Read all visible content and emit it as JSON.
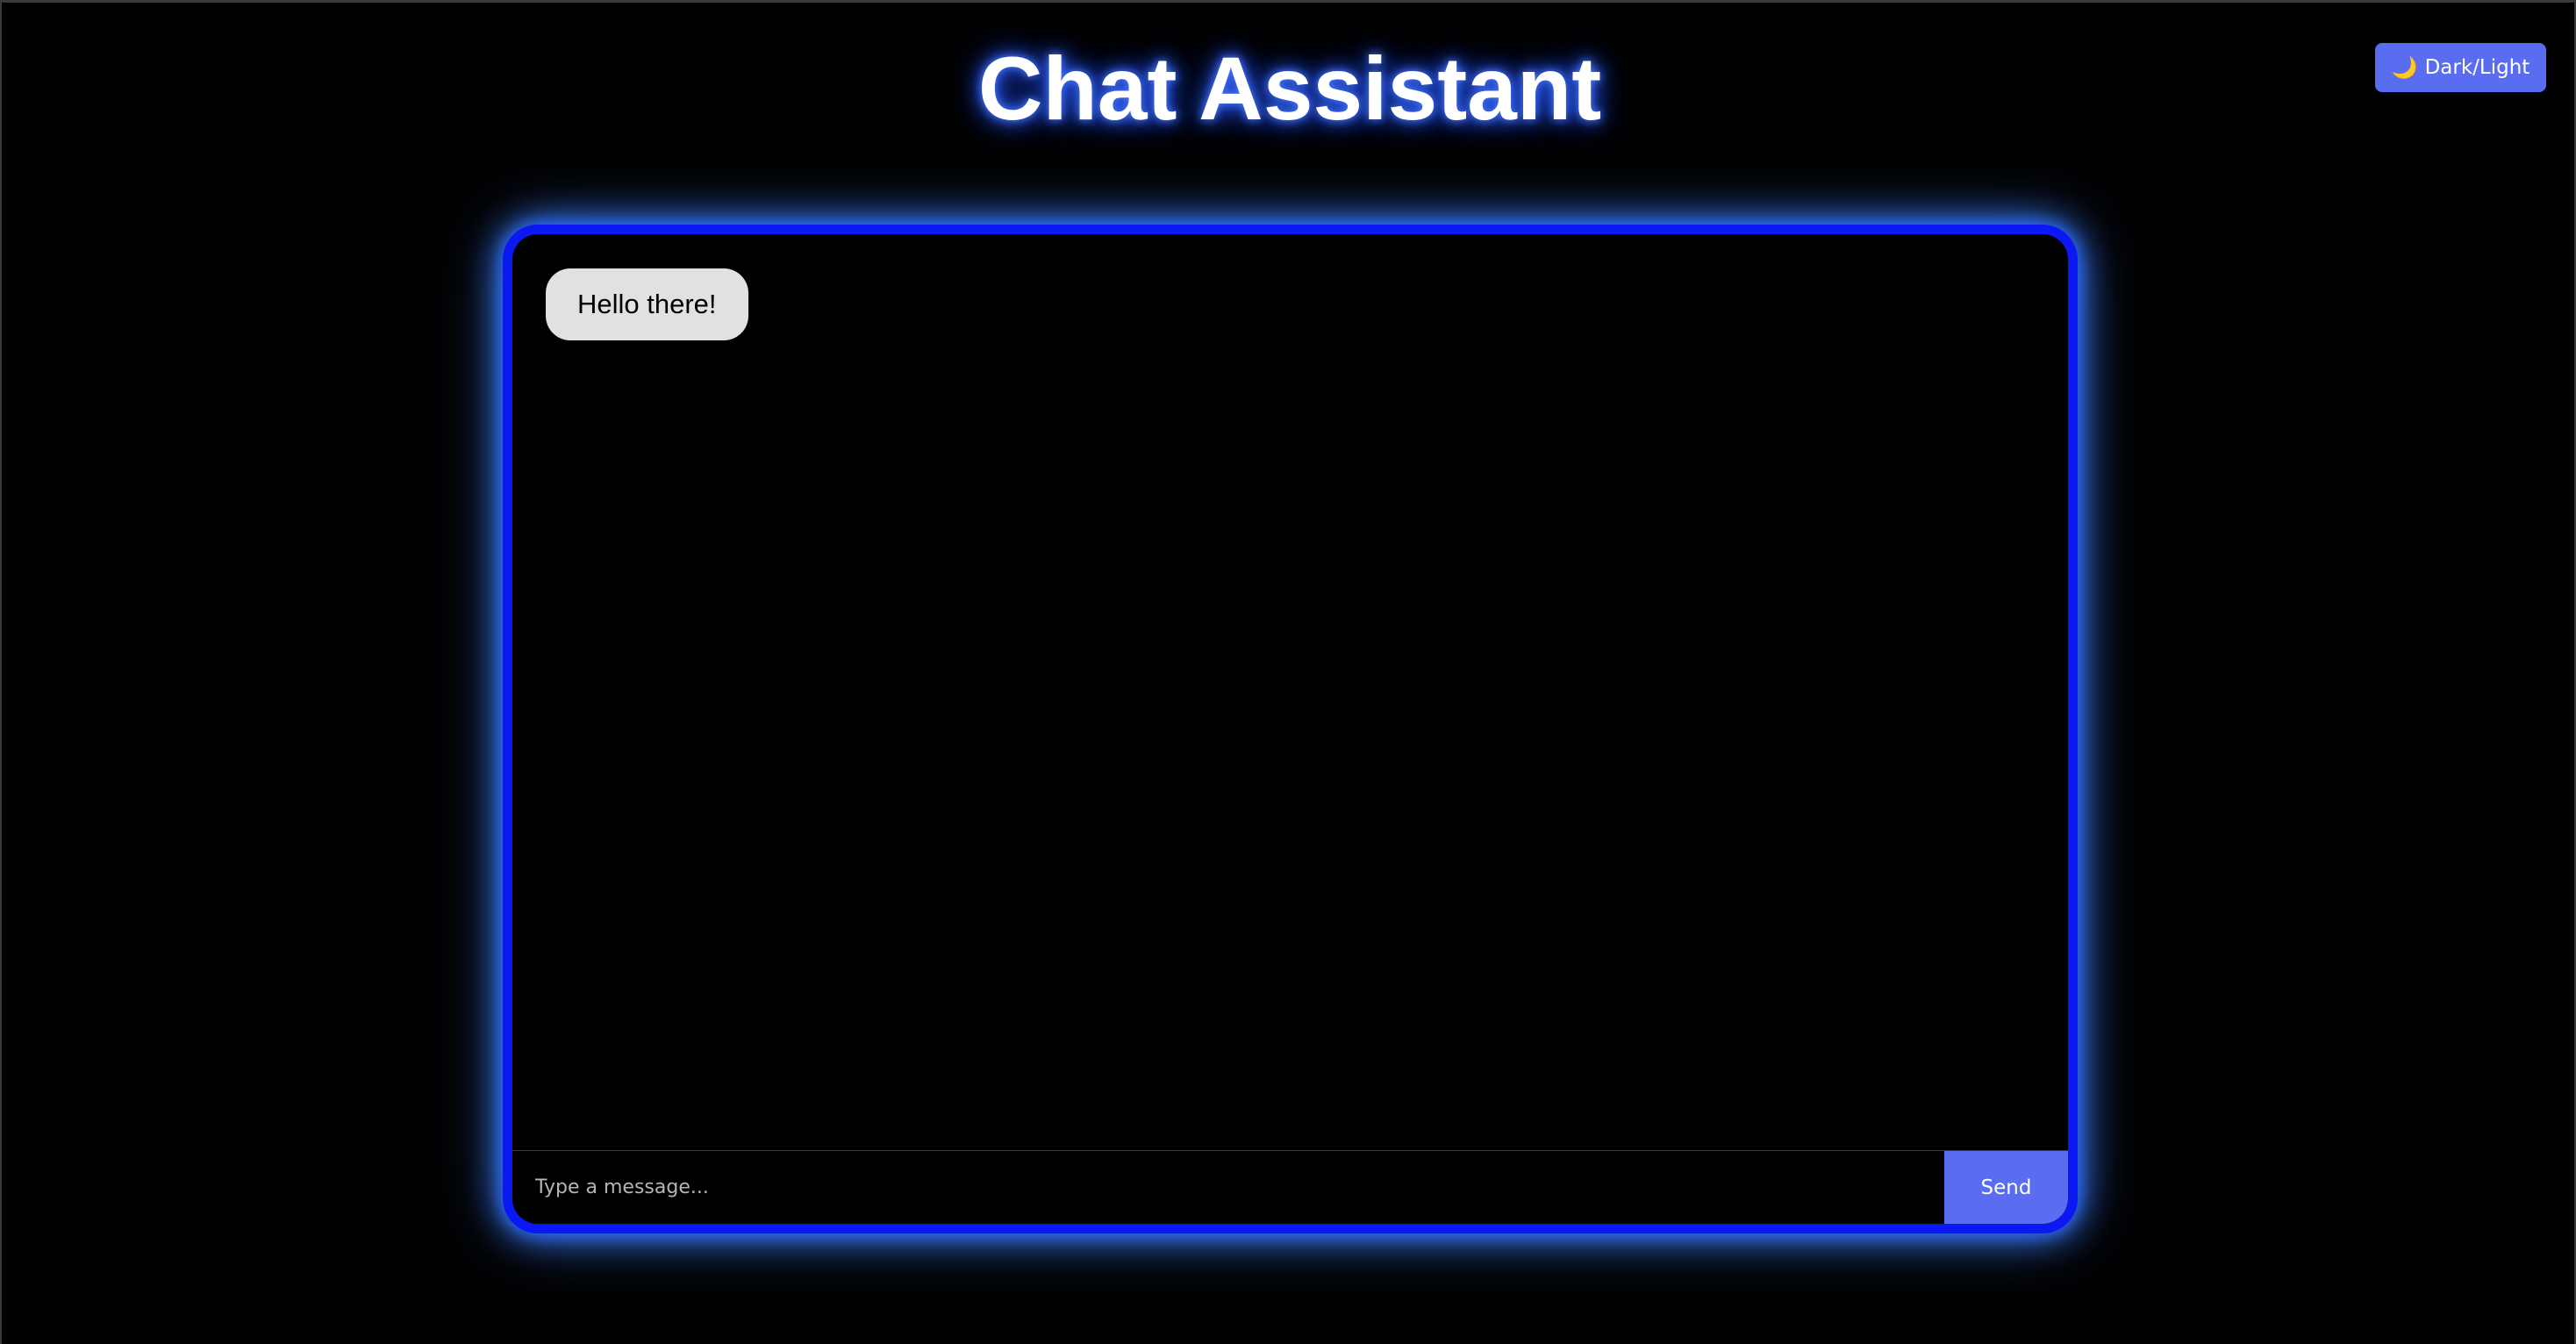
{
  "app": {
    "title": "Chat Assistant"
  },
  "theme_toggle": {
    "icon": "moon-icon",
    "icon_glyph": "🌙",
    "label": "Dark/Light"
  },
  "messages": [
    {
      "text": "Hello there!"
    }
  ],
  "composer": {
    "placeholder": "Type a message...",
    "value": "",
    "send_label": "Send"
  },
  "colors": {
    "background": "#000000",
    "accent": "#5a6cf0",
    "frame_border": "#0c18f4",
    "glow": "#3a7dff",
    "bubble": "#e1e1e1"
  }
}
